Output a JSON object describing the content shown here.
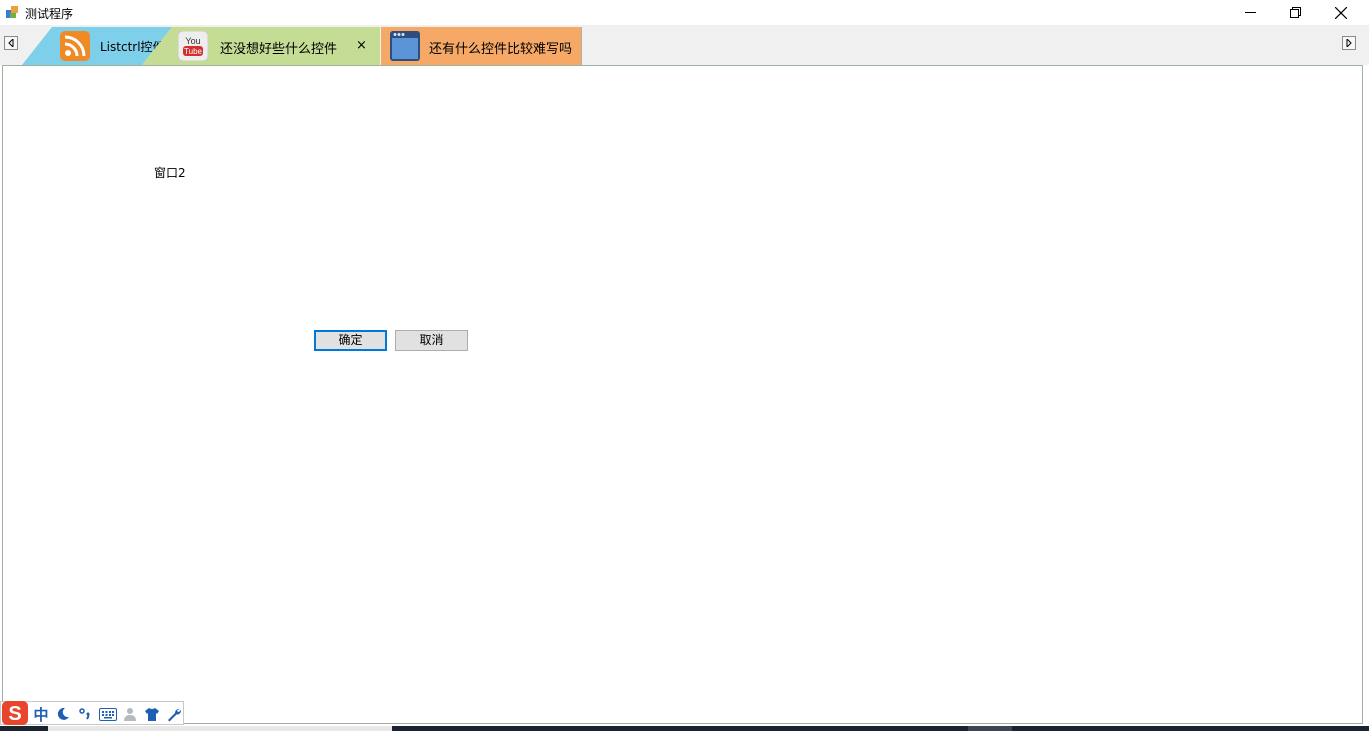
{
  "window": {
    "title": "测试程序",
    "icons": [
      "app-icon",
      "minimize-icon",
      "restore-icon",
      "close-icon"
    ]
  },
  "tabs": [
    {
      "label": "Listctrl控件",
      "icon": "rss-icon",
      "color": "#7ecfe9",
      "active": false
    },
    {
      "label": "还没想好些什么控件",
      "icon": "youtube-icon",
      "color": "#c4dc94",
      "active": true,
      "close_label": "×"
    },
    {
      "label": "还有什么控件比较难写吗",
      "icon": "window-app-icon",
      "color": "#f6a866",
      "active": false
    }
  ],
  "tab_scroll": {
    "left_icon": "scroll-left-icon",
    "right_icon": "scroll-right-icon"
  },
  "content": {
    "static_label": "窗口2",
    "ok_label": "确定",
    "cancel_label": "取消"
  },
  "ime_toolbar": {
    "mode_label": "中",
    "icons": [
      "sogou-logo-icon",
      "moon-icon",
      "punctuation-icon",
      "keyboard-icon",
      "user-icon",
      "skin-shirt-icon",
      "wrench-icon"
    ]
  },
  "colors": {
    "accent": "#0078d7",
    "tab_rss": "#7ecfe9",
    "tab_youtube": "#c4dc94",
    "tab_window": "#f6a866"
  }
}
